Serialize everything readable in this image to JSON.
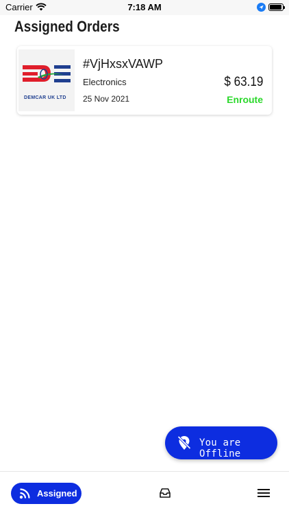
{
  "status_bar": {
    "carrier": "Carrier",
    "time": "7:18 AM"
  },
  "page": {
    "title": "Assigned Orders"
  },
  "orders": [
    {
      "id": "#VjHxsxVAWP",
      "category": "Electronics",
      "date": "25 Nov 2021",
      "price": "$ 63.19",
      "status": "Enroute",
      "logo_text": "DEMCAR UK LTD"
    }
  ],
  "fab": {
    "label": "You are Offline",
    "icon": "location-off-icon"
  },
  "bottom_nav": {
    "assigned_label": "Assigned",
    "assigned_icon": "rss-feed-icon",
    "inbox_icon": "inbox-tray-icon",
    "menu_icon": "hamburger-menu-icon"
  },
  "colors": {
    "accent": "#0d2de0",
    "status_enroute": "#2ad82a",
    "logo_red": "#e01e2b",
    "logo_blue": "#1f3f8f"
  }
}
